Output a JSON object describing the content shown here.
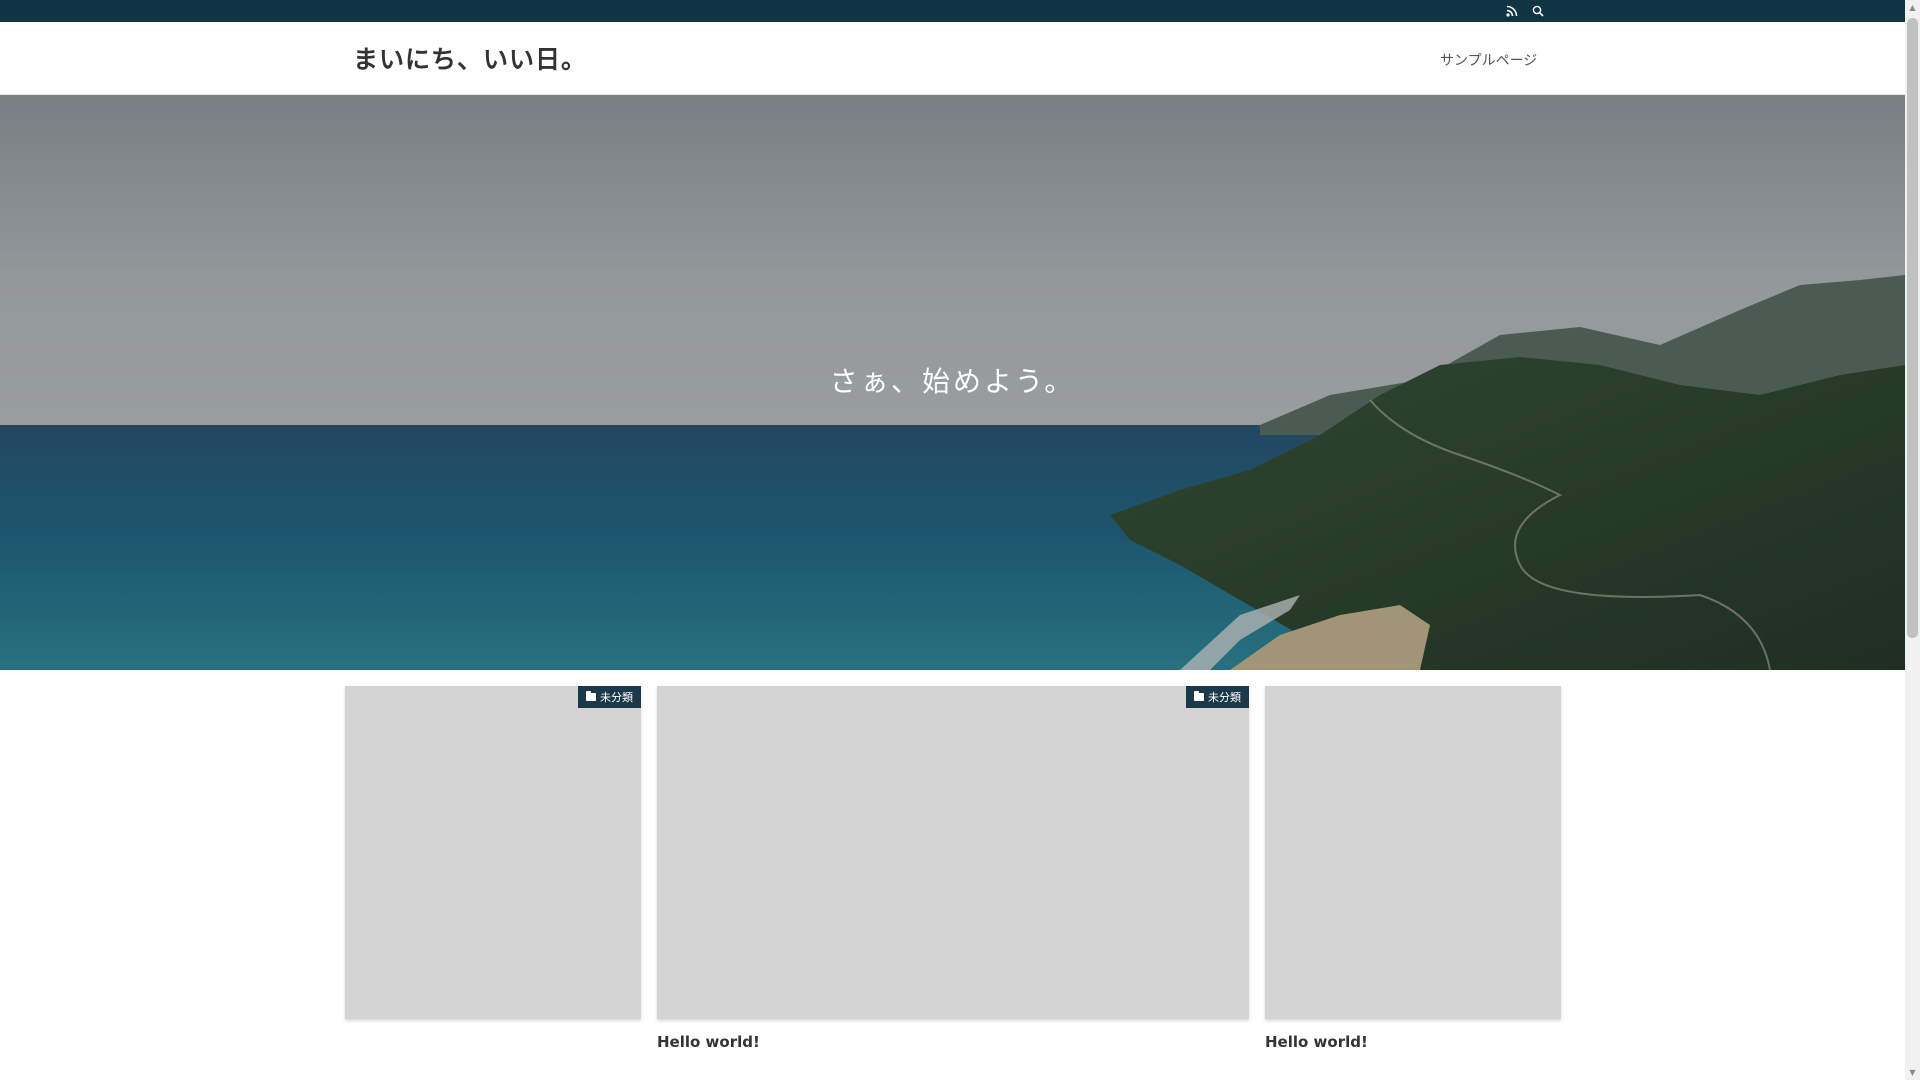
{
  "topbar": {
    "icons": [
      "rss-icon",
      "search-icon"
    ],
    "background": "#0f3443"
  },
  "header": {
    "site_title": "まいにち、いい日。",
    "nav": [
      {
        "label": "サンプルページ"
      }
    ]
  },
  "hero": {
    "tagline": "さぁ、始めよう。"
  },
  "cards": [
    {
      "category": "未分類",
      "title": ""
    },
    {
      "category": "未分類",
      "title": "Hello world!"
    },
    {
      "category": "",
      "title": "Hello world!"
    }
  ],
  "colors": {
    "accent": "#1a3a4a",
    "thumb_placeholder": "#d4d4d4"
  }
}
